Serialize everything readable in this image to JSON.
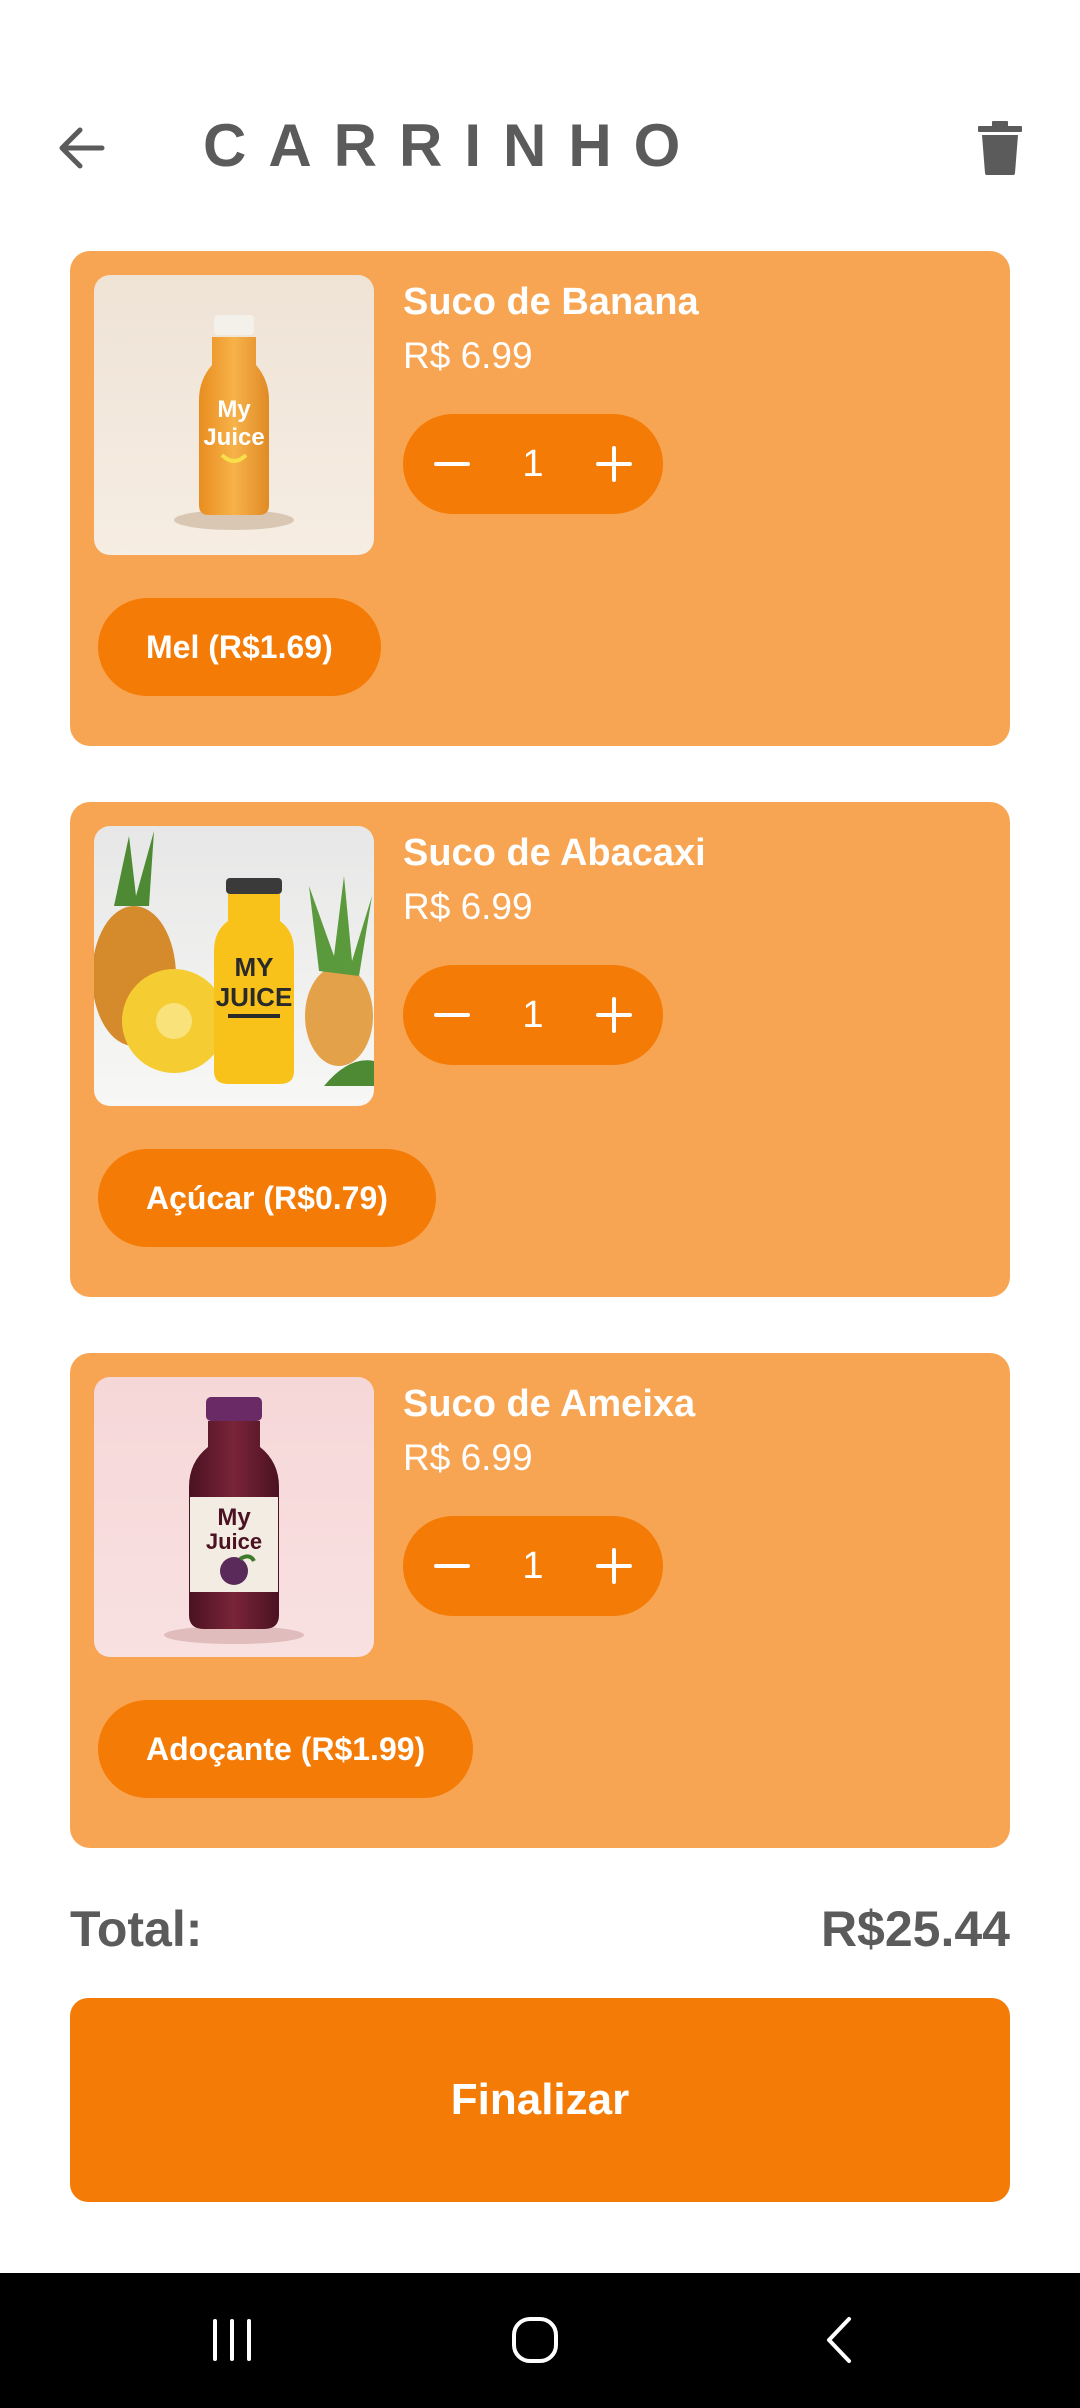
{
  "header": {
    "title": "CARRINHO",
    "back_icon": "arrow-left-icon",
    "trash_icon": "trash-icon"
  },
  "colors": {
    "accent": "#f47b06",
    "card_bg": "#f8a553",
    "text_dark": "#5b5b5b"
  },
  "items": [
    {
      "name": "Suco de Banana",
      "price": "R$ 6.99",
      "quantity": "1",
      "addon": "Mel (R$1.69)",
      "image_text": "My Juice"
    },
    {
      "name": "Suco de Abacaxi",
      "price": "R$ 6.99",
      "quantity": "1",
      "addon": "Açúcar (R$0.79)",
      "image_text": "MY JUICE"
    },
    {
      "name": "Suco de Ameixa",
      "price": "R$ 6.99",
      "quantity": "1",
      "addon": "Adoçante (R$1.99)",
      "image_text": "My Juice"
    }
  ],
  "summary": {
    "total_label": "Total:",
    "total_value": "R$25.44",
    "finish_label": "Finalizar"
  },
  "navbar": {
    "recents_icon": "recent-apps-icon",
    "home_icon": "home-icon",
    "back_icon": "back-chevron-icon"
  }
}
